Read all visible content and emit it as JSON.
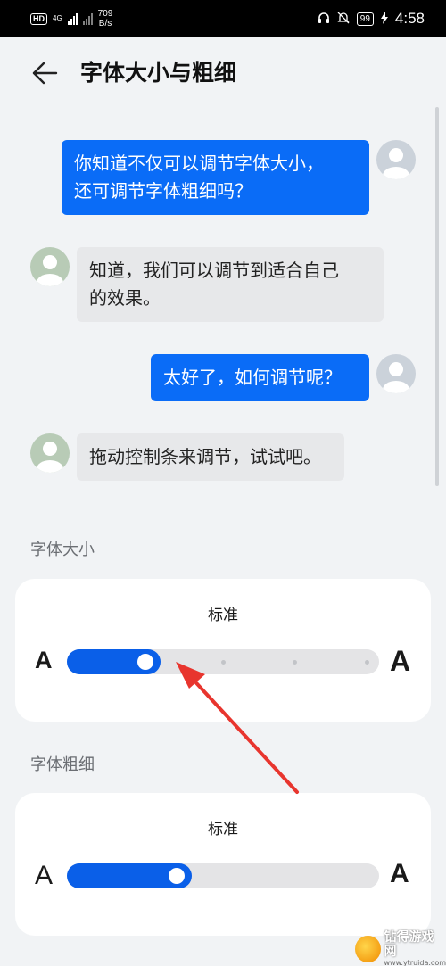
{
  "status_bar": {
    "hd_label": "HD",
    "network_label": "4G",
    "speed_value": "709",
    "speed_unit": "B/s",
    "battery": "99",
    "time": "4:58"
  },
  "header": {
    "title": "字体大小与粗细",
    "back_icon": "arrow-left-icon"
  },
  "chat": [
    {
      "from": "me",
      "text_line1": "你知道不仅可以调节字体大小，",
      "text_line2": "还可调节字体粗细吗？"
    },
    {
      "from": "them",
      "text_line1": "知道，我们可以调节到适合自己",
      "text_line2": "的效果。"
    },
    {
      "from": "me",
      "text": "太好了，如何调节呢？"
    },
    {
      "from": "them",
      "text": "拖动控制条来调节，试试吧。"
    }
  ],
  "font_size": {
    "label": "字体大小",
    "value": "标准",
    "small_glyph": "A",
    "large_glyph": "A",
    "level": 2,
    "levels": 6
  },
  "font_weight": {
    "label": "字体粗细",
    "value": "标准",
    "light_glyph": "A",
    "bold_glyph": "A",
    "level_fraction": 0.4
  },
  "watermark": {
    "name": "钻得游戏网",
    "url": "www.ytruida.com"
  },
  "colors": {
    "accent": "#0a5fe8",
    "bubble_me": "#0a6cf7",
    "bubble_them": "#e7e8ea",
    "background": "#f1f3f5",
    "annotation_arrow": "#e8352e"
  }
}
